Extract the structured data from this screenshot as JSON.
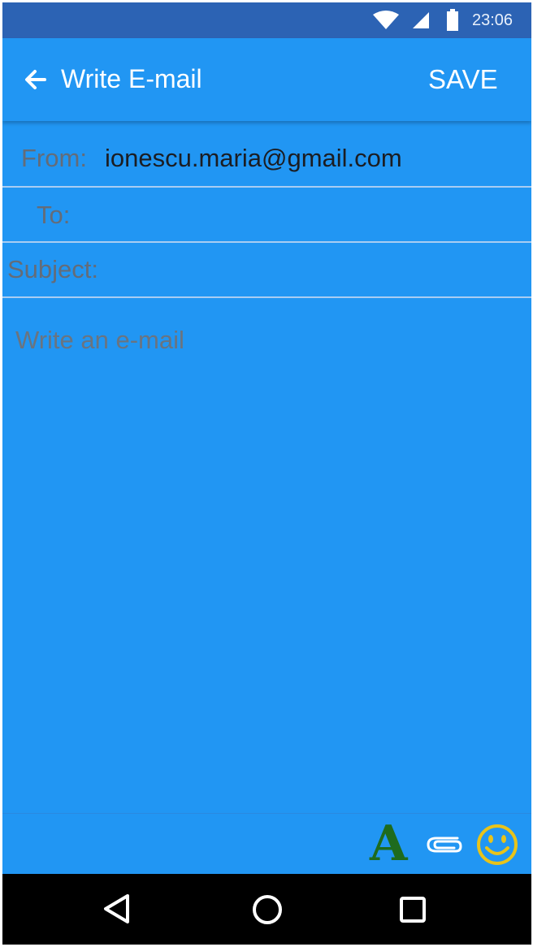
{
  "status_bar": {
    "time": "23:06",
    "icons": [
      "wifi-icon",
      "cell-signal-icon",
      "battery-icon"
    ]
  },
  "app_bar": {
    "title": "Write E-mail",
    "save_label": "SAVE",
    "back_icon": "arrow-left-icon"
  },
  "form": {
    "from_label": "From:",
    "from_value": "ionescu.maria@gmail.com",
    "to_label": "To:",
    "to_value": "",
    "subject_label": "Subject:",
    "subject_value": "",
    "body_placeholder": "Write an e-mail"
  },
  "toolbar": {
    "font_label": "A",
    "icons": [
      "text-format-icon",
      "paperclip-icon",
      "smiley-icon"
    ],
    "font_color": "#1e6b1e",
    "emoji_color": "#e8c31a"
  },
  "nav_bar": {
    "icons": [
      "nav-back-icon",
      "nav-home-icon",
      "nav-recents-icon"
    ]
  },
  "colors": {
    "primary": "#2196F3",
    "status_bar": "#2c63b4",
    "label_text": "#646c78",
    "divider": "#a9cdf2"
  }
}
